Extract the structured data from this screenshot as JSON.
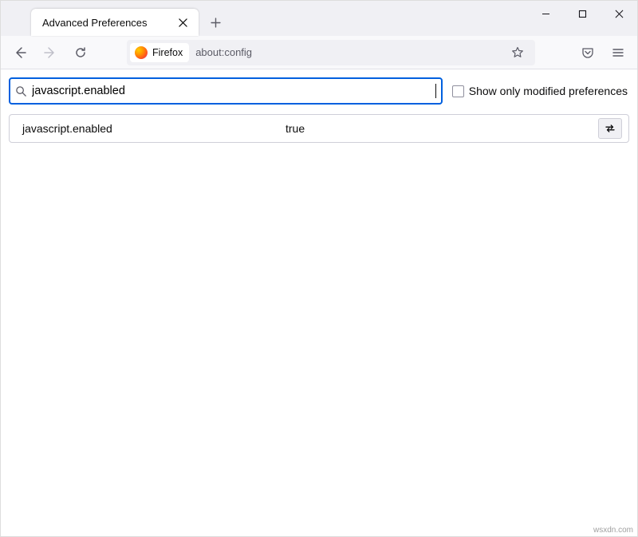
{
  "tab": {
    "title": "Advanced Preferences"
  },
  "identity": {
    "label": "Firefox"
  },
  "url": {
    "value": "about:config"
  },
  "search": {
    "value": "javascript.enabled",
    "checkbox_label": "Show only modified preferences"
  },
  "prefs": [
    {
      "name": "javascript.enabled",
      "value": "true"
    }
  ],
  "watermark": "wsxdn.com"
}
